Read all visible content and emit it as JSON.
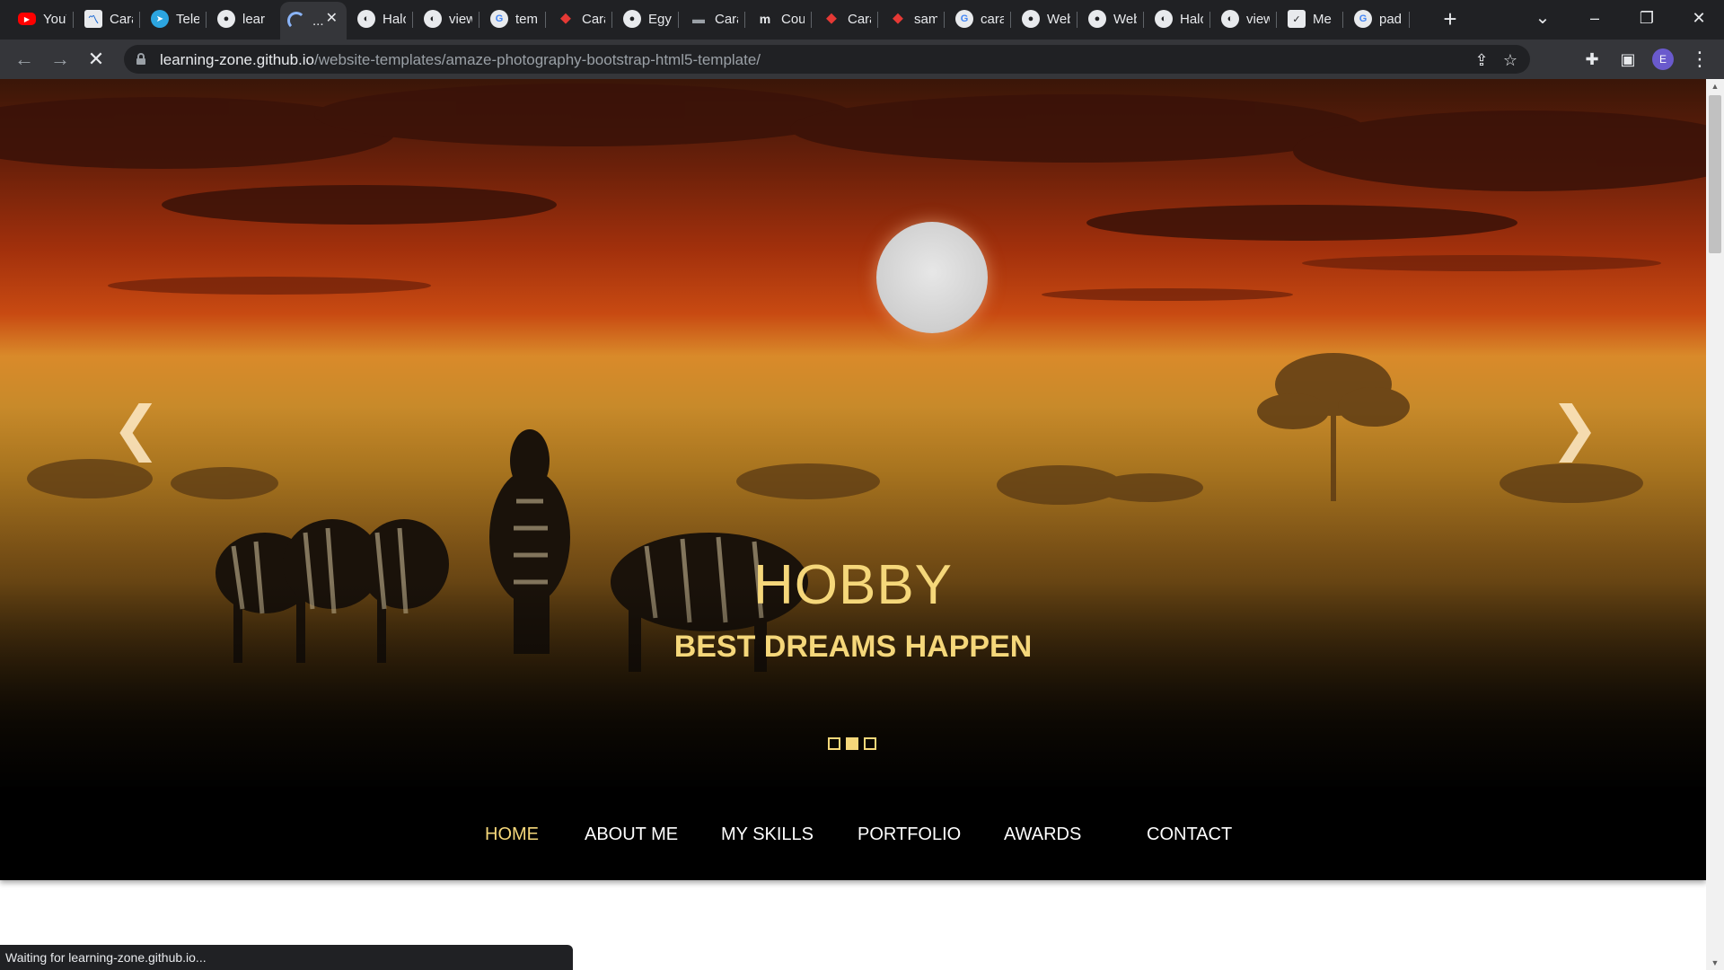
{
  "browser": {
    "tabs": [
      {
        "label": "YouTube",
        "icon": "youtube-icon",
        "color": "#ff0000"
      },
      {
        "label": "Cara",
        "icon": "chart-icon",
        "color": "#4fa3f7"
      },
      {
        "label": "Telegram",
        "icon": "telegram-icon",
        "color": "#2ca5e0"
      },
      {
        "label": "learning-zone",
        "icon": "github-icon",
        "color": "#e8eaed"
      },
      {
        "label": "...",
        "icon": "loading-icon",
        "color": "#8ab4f8",
        "active": true
      },
      {
        "label": "Halo",
        "icon": "globe-icon",
        "color": "#e8eaed"
      },
      {
        "label": "view",
        "icon": "globe-icon",
        "color": "#e8eaed"
      },
      {
        "label": "template",
        "icon": "google-icon",
        "color": "#e8eaed"
      },
      {
        "label": "Cara",
        "icon": "pin-icon",
        "color": "#e53935"
      },
      {
        "label": "Egypt",
        "icon": "github-icon",
        "color": "#e8eaed"
      },
      {
        "label": "Cara",
        "icon": "dash-icon",
        "color": "#9aa0a6"
      },
      {
        "label": "Coursera",
        "icon": "m-icon",
        "color": "#e8eaed"
      },
      {
        "label": "Cara",
        "icon": "pin-icon",
        "color": "#e53935"
      },
      {
        "label": "sam",
        "icon": "pin-icon",
        "color": "#e53935"
      },
      {
        "label": "cara",
        "icon": "google-icon",
        "color": "#e8eaed"
      },
      {
        "label": "Web",
        "icon": "github-icon",
        "color": "#e8eaed"
      },
      {
        "label": "Web",
        "icon": "github-icon",
        "color": "#e8eaed"
      },
      {
        "label": "Halo",
        "icon": "globe-icon",
        "color": "#e8eaed"
      },
      {
        "label": "view",
        "icon": "globe-icon",
        "color": "#e8eaed"
      },
      {
        "label": "Me",
        "icon": "checkbox-icon",
        "color": "#e8eaed"
      },
      {
        "label": "pad",
        "icon": "google-icon",
        "color": "#e8eaed"
      }
    ],
    "new_tab": "+",
    "tab_search": "⌄",
    "minimize": "–",
    "restore": "❐",
    "close": "✕",
    "back": "←",
    "forward": "→",
    "stop": "✕",
    "url_host": "learning-zone.github.io",
    "url_path": "/website-templates/amaze-photography-bootstrap-html5-template/",
    "share": "⇪",
    "bookmark": "☆",
    "extensions": "✚",
    "sidepanel": "▣",
    "profile_initial": "E",
    "menu": "⋮",
    "status_text": "Waiting for learning-zone.github.io..."
  },
  "hero": {
    "title": "HOBBY",
    "subtitle": "BEST DREAMS HAPPEN",
    "prev": "❮",
    "next": "❯",
    "slide_count": 3,
    "active_slide": 1,
    "accent": "#f5d77a"
  },
  "nav": {
    "items": [
      {
        "label": "HOME",
        "active": true
      },
      {
        "label": "ABOUT ME"
      },
      {
        "label": "MY SKILLS"
      },
      {
        "label": "PORTFOLIO"
      },
      {
        "label": "AWARDS"
      },
      {
        "label": "CONTACT"
      }
    ]
  },
  "scrollbar": {
    "up": "▲",
    "down": "▼"
  }
}
